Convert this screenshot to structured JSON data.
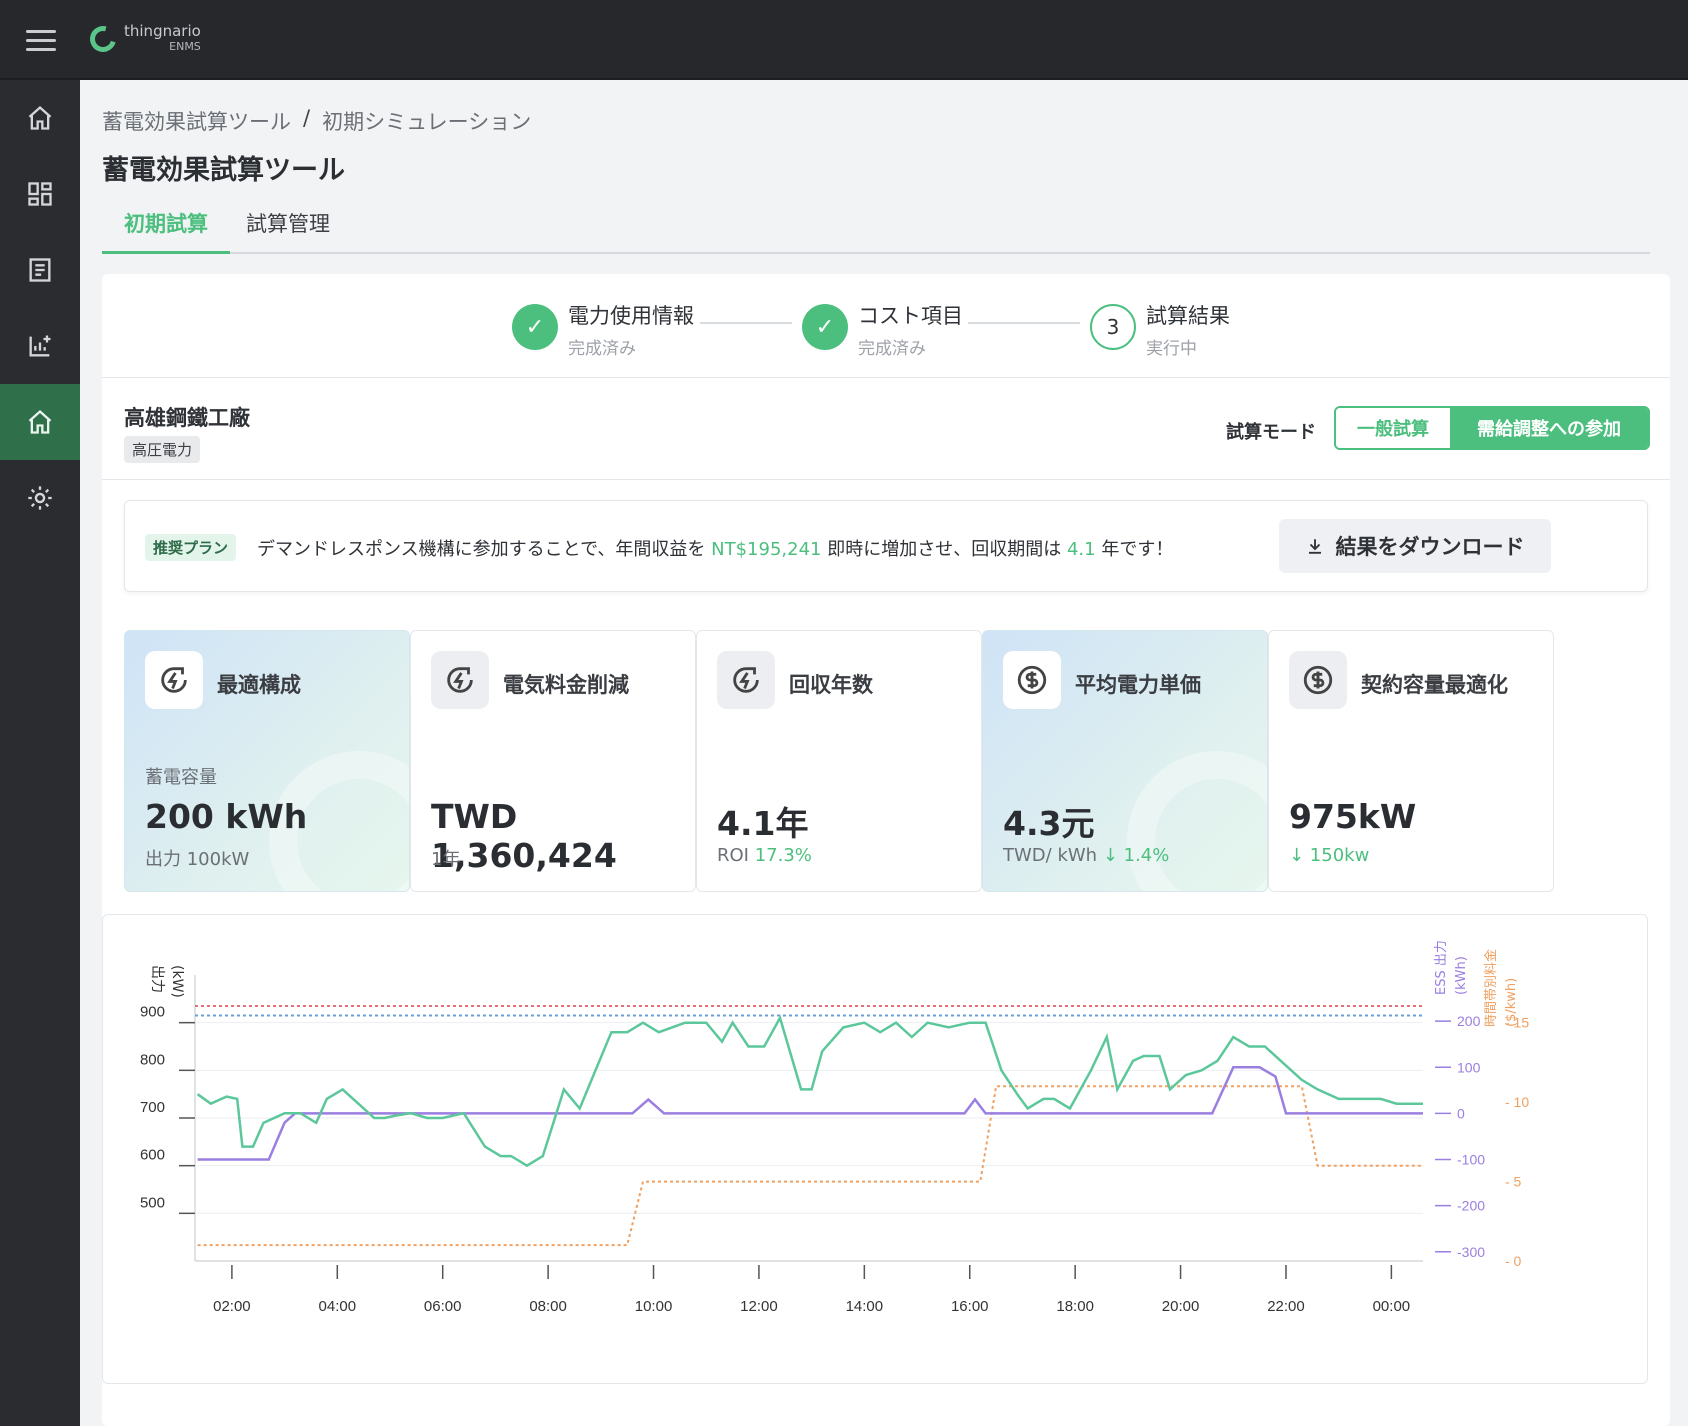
{
  "app": {
    "logo_text": "thingnario",
    "logo_sub": "ENMS"
  },
  "breadcrumb": {
    "root": "蓄電効果試算ツール",
    "sep": "/",
    "current": "初期シミュレーション"
  },
  "page_title": "蓄電効果試算ツール",
  "tabs": [
    {
      "label": "初期試算",
      "active": true
    },
    {
      "label": "試算管理",
      "active": false
    }
  ],
  "stepper": [
    {
      "title": "電力使用情報",
      "status": "完成済み",
      "state": "done"
    },
    {
      "title": "コスト項目",
      "status": "完成済み",
      "state": "done"
    },
    {
      "title": "試算結果",
      "status": "実行中",
      "state": "current",
      "number": "3"
    }
  ],
  "site": {
    "name": "高雄鋼鐵工廠",
    "badge": "高圧電力"
  },
  "mode": {
    "label": "試算モード",
    "options": [
      "一般試算",
      "需給調整への参加"
    ],
    "selected": "需給調整への参加"
  },
  "recommendation": {
    "tag": "推奨プラン",
    "text_1": "デマンドレスポンス機構に参加することで、年間収益を",
    "revenue": "NT$195,241",
    "text_2": "即時に増加させ、回収期間は",
    "payback": "4.1",
    "text_3": "年です！",
    "download_label": "結果をダウンロード"
  },
  "kpis": [
    {
      "title": "最適構成",
      "sub": "蓄電容量",
      "value": "200 kWh",
      "foot": "出力 100kW",
      "foot_green": "",
      "icon": "energy-icon",
      "highlight": true
    },
    {
      "title": "電気料金削減",
      "sub": "",
      "value": "TWD 1,360,424",
      "foot": "1年",
      "foot_green": "",
      "icon": "energy-icon",
      "highlight": false
    },
    {
      "title": "回収年数",
      "sub": "",
      "value": "4.1年",
      "foot": "ROI",
      "foot_green": "17.3%",
      "icon": "energy-icon",
      "highlight": false
    },
    {
      "title": "平均電力単価",
      "sub": "",
      "value": "4.3元",
      "foot": "TWD/ kWh",
      "foot_green": "↓ 1.4%",
      "icon": "dollar-icon",
      "highlight": true
    },
    {
      "title": "契約容量最適化",
      "sub": "",
      "value": "975kW",
      "foot": "",
      "foot_green": "↓ 150kw",
      "icon": "dollar-icon",
      "highlight": false
    }
  ],
  "colors": {
    "accent": "#4cbf7f",
    "load": "#5cc79a",
    "ess": "#9a7fe0",
    "price": "#f0a060",
    "limit_red": "#e8707a",
    "limit_blue": "#6aa0d8",
    "gray": "#b7b7bc"
  },
  "chart_data": {
    "type": "line",
    "y_left_label": "出力\n(kW)",
    "y_right1_label": "ESS 出力\n(kWh)",
    "y_right2_label": "時間帯別料金\n($/kwh)",
    "y_left_ticks": [
      500,
      600,
      700,
      800,
      900
    ],
    "y_left_range": [
      400,
      1000
    ],
    "y_right1_ticks": [
      -300,
      -200,
      -100,
      0,
      100,
      200
    ],
    "y_right1_range": [
      -320,
      300
    ],
    "y_right2_ticks": [
      0,
      5,
      10,
      15
    ],
    "y_right2_range": [
      0,
      18
    ],
    "x_ticks": [
      "02:00",
      "04:00",
      "06:00",
      "08:00",
      "10:00",
      "12:00",
      "14:00",
      "16:00",
      "18:00",
      "20:00",
      "22:00",
      "00:00"
    ],
    "x_range": [
      1.3,
      24.6
    ],
    "limit_red": 935,
    "limit_blue": 915,
    "series": [
      {
        "name": "load",
        "x": [
          1.35,
          1.6,
          1.9,
          2.1,
          2.2,
          2.4,
          2.6,
          3.0,
          3.3,
          3.6,
          3.8,
          4.1,
          4.4,
          4.7,
          4.9,
          5.1,
          5.4,
          5.7,
          6.0,
          6.4,
          6.8,
          7.1,
          7.3,
          7.6,
          7.9,
          8.1,
          8.3,
          8.6,
          8.9,
          9.2,
          9.5,
          9.8,
          10.1,
          10.6,
          11.0,
          11.3,
          11.5,
          11.8,
          12.1,
          12.4,
          12.8,
          13.0,
          13.2,
          13.6,
          14.0,
          14.3,
          14.6,
          14.9,
          15.2,
          15.6,
          16.0,
          16.3,
          16.6,
          16.9,
          17.1,
          17.4,
          17.6,
          17.9,
          18.3,
          18.6,
          18.8,
          19.1,
          19.3,
          19.6,
          19.8,
          20.1,
          20.4,
          20.7,
          21.0,
          21.3,
          21.6,
          21.9,
          22.3,
          22.6,
          23.0,
          23.4,
          23.8,
          24.1,
          24.6
        ],
        "y": [
          750,
          730,
          745,
          740,
          640,
          640,
          690,
          710,
          710,
          690,
          740,
          760,
          730,
          700,
          700,
          705,
          710,
          700,
          700,
          710,
          640,
          620,
          620,
          600,
          620,
          690,
          760,
          720,
          800,
          880,
          880,
          900,
          880,
          900,
          900,
          860,
          900,
          850,
          850,
          910,
          760,
          760,
          840,
          890,
          900,
          880,
          900,
          870,
          900,
          890,
          900,
          900,
          800,
          750,
          720,
          740,
          740,
          720,
          800,
          870,
          760,
          820,
          830,
          830,
          760,
          790,
          800,
          820,
          870,
          850,
          850,
          820,
          780,
          760,
          740,
          740,
          740,
          730,
          730
        ]
      },
      {
        "name": "ess",
        "x": [
          1.35,
          2.7,
          3.0,
          3.2,
          3.6,
          9.6,
          9.9,
          10.2,
          15.6,
          15.9,
          16.1,
          16.3,
          20.3,
          20.6,
          21.0,
          21.5,
          21.8,
          22.0,
          24.6
        ],
        "y": [
          -100,
          -100,
          -20,
          0,
          0,
          0,
          30,
          0,
          0,
          0,
          30,
          0,
          0,
          0,
          100,
          100,
          80,
          0,
          0
        ]
      },
      {
        "name": "price",
        "x": [
          1.35,
          9.5,
          9.8,
          16.2,
          16.5,
          22.3,
          22.6,
          24.6
        ],
        "y": [
          1,
          1,
          5,
          5,
          11,
          11,
          6,
          6
        ]
      },
      {
        "name": "gray",
        "x": [
          20.3,
          20.8,
          21.3,
          21.6,
          21.9,
          22.2,
          9.8,
          10.1,
          10.4,
          15.6,
          15.9,
          16.2
        ],
        "y": [
          790,
          840,
          860,
          860,
          840,
          810,
          900,
          930,
          900,
          900,
          930,
          900
        ]
      }
    ]
  }
}
